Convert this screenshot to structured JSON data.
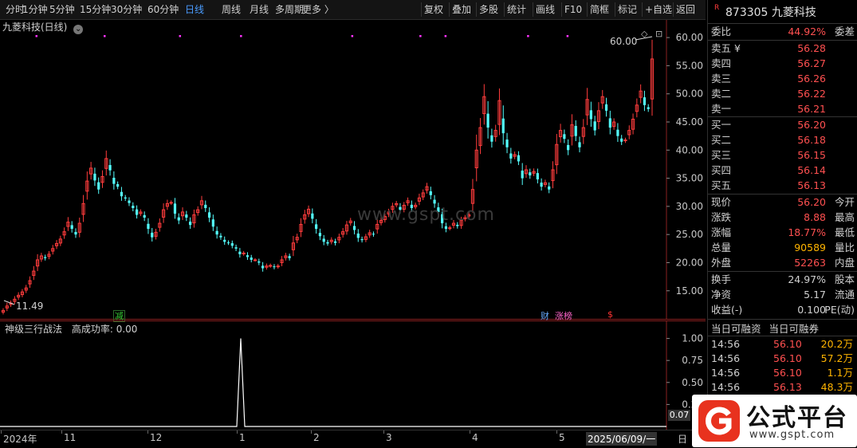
{
  "toolbar": {
    "left_items": [
      "分时",
      "1分钟",
      "5分钟",
      "15分钟",
      "30分钟",
      "60分钟",
      "日线",
      "周线",
      "月线",
      "多周期",
      "更多 〉"
    ],
    "active": "日线",
    "right_items": [
      "复权",
      "叠加",
      "多股",
      "统计",
      "画线",
      "F10",
      "简框",
      "标记",
      "+自选",
      "返回"
    ]
  },
  "main": {
    "stock_title": "九菱科技(日线)",
    "settings_icon": "gear-icon",
    "high_label": "60.00",
    "low_label": "11.49",
    "watermark": "www.gspt.com",
    "marks": [
      {
        "text": "减",
        "color": "#33cc33"
      },
      {
        "text": "财",
        "color": "#66aaff"
      },
      {
        "text": "涨榜",
        "color": "#ff66cc"
      },
      {
        "text": "$",
        "color": "#ff3333"
      }
    ]
  },
  "indicator": {
    "title": "神级三行战法",
    "label": "高成功率:",
    "value": "0.00",
    "current_value": "0.07"
  },
  "x_axis": {
    "labels": [
      "2024年",
      "11",
      "12",
      "1",
      "2",
      "3",
      "4",
      "5",
      "2025/06/09/一",
      "日"
    ]
  },
  "right_panel": {
    "badge": "R",
    "code": "873305",
    "name": "九菱科技",
    "wei_bi_label": "委比",
    "wei_bi_value": "44.92%",
    "wei_cha_label": "委差",
    "asks": [
      {
        "label": "卖五 ¥",
        "price": "56.28"
      },
      {
        "label": "卖四",
        "price": "56.27"
      },
      {
        "label": "卖三",
        "price": "56.26"
      },
      {
        "label": "卖二",
        "price": "56.22"
      },
      {
        "label": "卖一",
        "price": "56.21"
      }
    ],
    "bids": [
      {
        "label": "买一",
        "price": "56.20"
      },
      {
        "label": "买二",
        "price": "56.18"
      },
      {
        "label": "买三",
        "price": "56.15"
      },
      {
        "label": "买四",
        "price": "56.14"
      },
      {
        "label": "买五",
        "price": "56.13"
      }
    ],
    "stats1": [
      {
        "l": "现价",
        "v": "56.20",
        "r": "今开",
        "vc": "#ff5050"
      },
      {
        "l": "涨跌",
        "v": "8.88",
        "r": "最高",
        "vc": "#ff5050"
      },
      {
        "l": "涨幅",
        "v": "18.77%",
        "r": "最低",
        "vc": "#ff5050"
      },
      {
        "l": "总量",
        "v": "90589",
        "r": "量比",
        "vc": "#ffb400"
      },
      {
        "l": "外盘",
        "v": "52263",
        "r": "内盘",
        "vc": "#ff5050"
      }
    ],
    "stats2": [
      {
        "l": "换手",
        "v": "24.97%",
        "r": "股本",
        "vc": "#d0d0d0"
      },
      {
        "l": "净资",
        "v": "5.17",
        "r": "流通",
        "vc": "#d0d0d0"
      },
      {
        "l": "收益(-)",
        "v": "0.100",
        "r": "PE(动)",
        "vc": "#d0d0d0"
      }
    ],
    "margin_tabs": [
      "当日可融资",
      "当日可融券"
    ],
    "trades": [
      {
        "t": "14:56",
        "p": "56.10",
        "q": "20.2万"
      },
      {
        "t": "14:56",
        "p": "56.10",
        "q": "57.2万"
      },
      {
        "t": "14:56",
        "p": "56.10",
        "q": "1.1万"
      },
      {
        "t": "14:56",
        "p": "56.13",
        "q": "48.3万"
      }
    ]
  },
  "logo": {
    "text": "公式平台",
    "url_text": "www.gspt.com"
  },
  "chart_data": {
    "type": "candlestick",
    "y_ticks": [
      15,
      20,
      25,
      30,
      35,
      40,
      45,
      50,
      55,
      60
    ],
    "ylim": [
      11,
      62
    ],
    "indicator_ticks": [
      0.25,
      0.5,
      0.75,
      1.0
    ],
    "indicator_ylim": [
      0,
      1.15
    ],
    "closes": [
      11.5,
      12.3,
      12.8,
      13.5,
      14.2,
      14.8,
      15.5,
      16.8,
      18.5,
      20.5,
      21.2,
      20.8,
      21.5,
      22.5,
      23.4,
      24.2,
      25.5,
      27.2,
      26.0,
      25.0,
      27.0,
      30.5,
      34.5,
      36.8,
      34.6,
      33.0,
      35.3,
      38.5,
      36.4,
      34.0,
      33.5,
      31.8,
      31.4,
      30.6,
      29.7,
      28.5,
      29.0,
      28.0,
      26.0,
      24.5,
      25.4,
      27.0,
      29.4,
      30.5,
      30.7,
      28.7,
      27.5,
      29.0,
      28.0,
      26.7,
      28.5,
      29.4,
      31.0,
      29.7,
      28.0,
      26.4,
      25.0,
      24.5,
      23.7,
      23.5,
      23.0,
      22.5,
      21.5,
      21.7,
      21.0,
      20.5,
      20.5,
      20.0,
      19.0,
      19.4,
      19.5,
      19.2,
      19.4,
      20.5,
      21.2,
      20.8,
      23.5,
      24.5,
      26.8,
      28.5,
      29.5,
      27.8,
      26.0,
      24.7,
      23.7,
      23.4,
      24.0,
      23.5,
      24.5,
      25.5,
      26.7,
      27.4,
      25.8,
      24.4,
      24.0,
      24.6,
      25.3,
      25.0,
      26.8,
      27.5,
      28.2,
      29.0,
      30.0,
      30.5,
      29.4,
      30.2,
      31.0,
      29.7,
      30.2,
      31.5,
      32.4,
      33.5,
      32.0,
      30.5,
      29.0,
      27.0,
      26.0,
      26.2,
      27.0,
      26.5,
      27.5,
      28.0,
      28.5,
      33.0,
      40.0,
      44.0,
      49.5,
      44.0,
      41.5,
      43.5,
      48.8,
      43.0,
      40.5,
      38.5,
      39.2,
      38.0,
      35.0,
      36.5,
      35.5,
      36.2,
      34.8,
      33.5,
      34.2,
      33.0,
      36.5,
      41.0,
      43.5,
      42.0,
      40.0,
      44.5,
      42.5,
      40.5,
      44.0,
      49.0,
      45.5,
      43.5,
      47.0,
      49.5,
      47.0,
      44.0,
      45.0,
      42.5,
      41.5,
      41.8,
      43.5,
      45.5,
      48.0,
      50.5,
      48.0,
      47.3,
      56.2
    ],
    "indicator_spike": {
      "x": "2025-01-02",
      "value": 1.0
    }
  }
}
